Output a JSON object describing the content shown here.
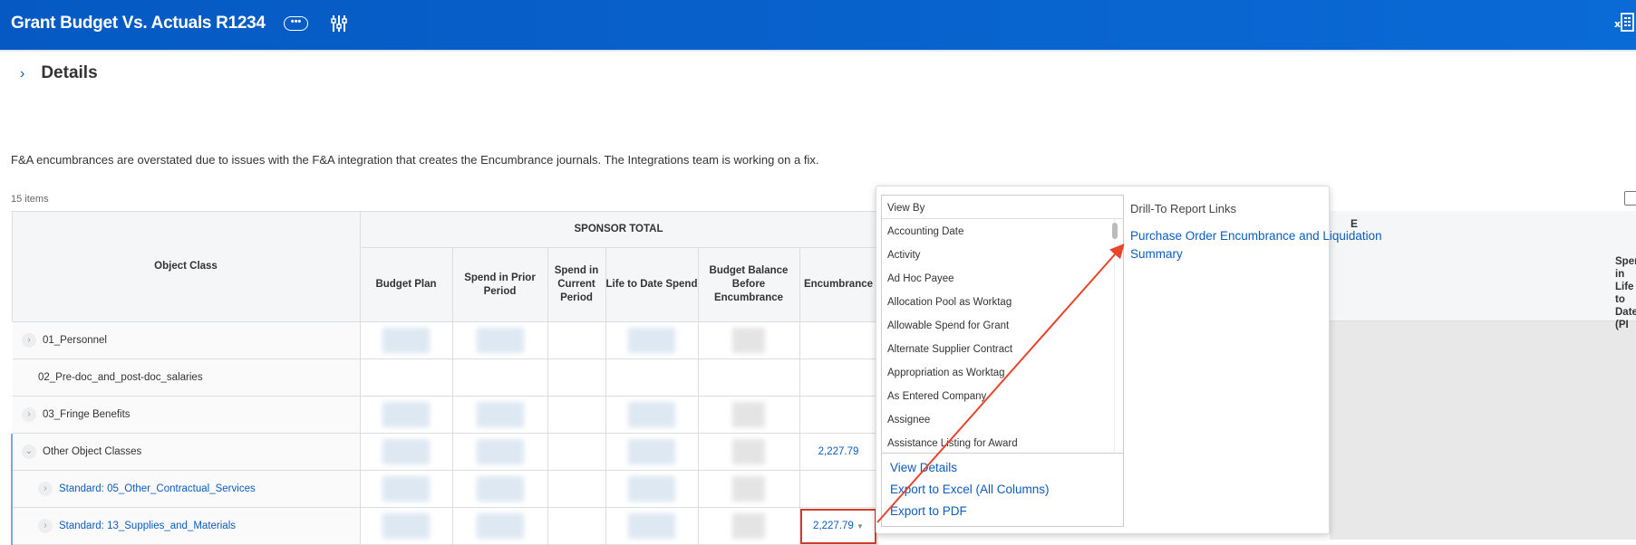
{
  "header": {
    "title": "Grant Budget Vs. Actuals R1234",
    "more_icon": "ellipsis-icon",
    "filter_icon": "sliders-icon",
    "export_icon": "excel-icon"
  },
  "details": {
    "label": "Details"
  },
  "message": "F&A encumbrances are overstated due to issues with the F&A integration that creates the Encumbrance journals. The Integrations team is working on a fix.",
  "table": {
    "count": "15 items",
    "group_header": "SPONSOR TOTAL",
    "columns": [
      "Object Class",
      "Budget Plan",
      "Spend in Prior Period",
      "Spend in Current Period",
      "Life to Date Spend",
      "Budget Balance Before Encumbrance",
      "Encumbrance"
    ],
    "rows": [
      {
        "label": "01_Personnel",
        "encumbrance": ""
      },
      {
        "label": "02_Pre-doc_and_post-doc_salaries",
        "encumbrance": ""
      },
      {
        "label": "03_Fringe Benefits",
        "encumbrance": ""
      },
      {
        "label": "Other Object Classes",
        "encumbrance": "2,227.79"
      },
      {
        "label": "Standard: 05_Other_Contractual_Services",
        "encumbrance": ""
      },
      {
        "label": "Standard: 13_Supplies_and_Materials",
        "encumbrance": "2,227.79"
      }
    ],
    "right_partial_header": "E",
    "right_partial_column": "Spend in Life to Date (PI"
  },
  "popup": {
    "view_by_label": "View By",
    "view_by_items": [
      "Accounting Date",
      "Activity",
      "Ad Hoc Payee",
      "Allocation Pool as Worktag",
      "Allowable Spend for Grant",
      "Alternate Supplier Contract",
      "Appropriation as Worktag",
      "As Entered Company",
      "Assignee",
      "Assistance Listing for Award"
    ],
    "actions": [
      "View Details",
      "Export to Excel (All Columns)",
      "Export to PDF"
    ],
    "drill_label": "Drill-To Report Links",
    "drill_links": [
      "Purchase Order Encumbrance and Liquidation Summary"
    ]
  },
  "colors": {
    "brand": "#0659c2",
    "link": "#0b5cbf",
    "annotation": "#d33a2c"
  }
}
